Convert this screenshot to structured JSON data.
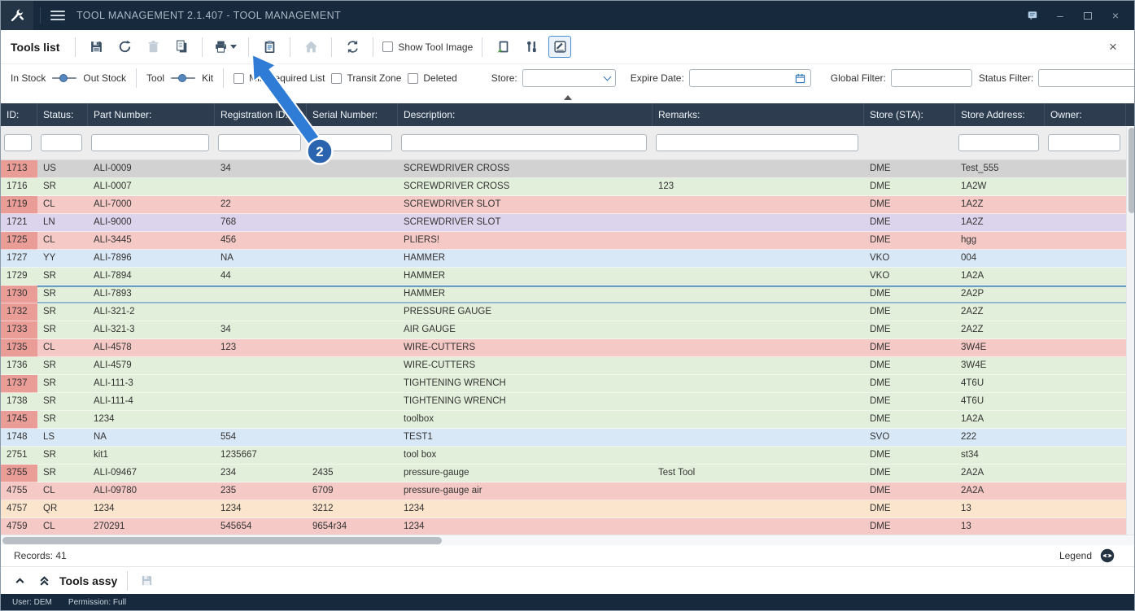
{
  "colors": {
    "titlebar": "#17293c",
    "table_header": "#2d3c4e",
    "accent": "#2e75b6",
    "row_green": "#e2efda",
    "row_pink": "#f5c9c6",
    "row_purple": "#dcd4ec",
    "row_blue": "#d9e8f7",
    "row_orange": "#fce5cd",
    "row_gray": "#d2d2d2",
    "id_alert": "#ea9c97",
    "callout_blue": "#2f7cd6",
    "callout_badge": "#2a63ae"
  },
  "titlebar": {
    "title": "TOOL MANAGEMENT 2.1.407 - TOOL MANAGEMENT",
    "minimize": "–",
    "close": "×"
  },
  "toolbar": {
    "heading": "Tools list",
    "show_tool_image": "Show Tool Image",
    "close": "×",
    "icons": [
      "save",
      "refresh",
      "delete",
      "copy",
      "print",
      "paste",
      "home",
      "transfer",
      "import-tool",
      "tool-settings",
      "edit"
    ]
  },
  "filterbar": {
    "in_stock": "In Stock",
    "out_stock": "Out Stock",
    "tool": "Tool",
    "kit": "Kit",
    "min_required_list": "Min Required List",
    "transit_zone": "Transit Zone",
    "deleted": "Deleted",
    "store_label": "Store:",
    "store_value": "",
    "expire_date_label": "Expire Date:",
    "expire_date_value": "",
    "global_filter_label": "Global Filter:",
    "global_filter_value": "",
    "status_filter_label": "Status Filter:",
    "status_filter_value": ""
  },
  "table": {
    "columns": [
      {
        "label": "ID:",
        "filter": true
      },
      {
        "label": "Status:",
        "filter": true
      },
      {
        "label": "Part Number:",
        "filter": true
      },
      {
        "label": "Registration ID:",
        "filter": true
      },
      {
        "label": "Serial Number:",
        "filter": true
      },
      {
        "label": "Description:",
        "filter": true
      },
      {
        "label": "Remarks:",
        "filter": true
      },
      {
        "label": "Store (STA):",
        "filter": false
      },
      {
        "label": "Store Address:",
        "filter": true
      },
      {
        "label": "Owner:",
        "filter": true
      }
    ],
    "rows": [
      {
        "id": "1713",
        "status": "US",
        "part_number": "ALI-0009",
        "registration_id": "34",
        "serial_number": "",
        "description": "SCREWDRIVER CROSS",
        "remarks": "",
        "store": "DME",
        "store_address": "Test_555",
        "owner": "",
        "color": "gray",
        "id_alert": true,
        "selected": false
      },
      {
        "id": "1716",
        "status": "SR",
        "part_number": "ALI-0007",
        "registration_id": "",
        "serial_number": "",
        "description": "SCREWDRIVER CROSS",
        "remarks": "123",
        "store": "DME",
        "store_address": "1A2W",
        "owner": "",
        "color": "green",
        "id_alert": false,
        "selected": false
      },
      {
        "id": "1719",
        "status": "CL",
        "part_number": "ALI-7000",
        "registration_id": "22",
        "serial_number": "",
        "description": "SCREWDRIVER SLOT",
        "remarks": "",
        "store": "DME",
        "store_address": "1A2Z",
        "owner": "",
        "color": "pink",
        "id_alert": true,
        "selected": false
      },
      {
        "id": "1721",
        "status": "LN",
        "part_number": "ALI-9000",
        "registration_id": "768",
        "serial_number": "",
        "description": "SCREWDRIVER SLOT",
        "remarks": "",
        "store": "DME",
        "store_address": "1A2Z",
        "owner": "",
        "color": "purple",
        "id_alert": false,
        "selected": false
      },
      {
        "id": "1725",
        "status": "CL",
        "part_number": "ALI-3445",
        "registration_id": "456",
        "serial_number": "",
        "description": "PLIERS!",
        "remarks": "",
        "store": "DME",
        "store_address": "hgg",
        "owner": "",
        "color": "pink",
        "id_alert": true,
        "selected": false
      },
      {
        "id": "1727",
        "status": "YY",
        "part_number": "ALI-7896",
        "registration_id": "NA",
        "serial_number": "",
        "description": "HAMMER",
        "remarks": "",
        "store": "VKO",
        "store_address": "004",
        "owner": "",
        "color": "blue",
        "id_alert": false,
        "selected": false
      },
      {
        "id": "1729",
        "status": "SR",
        "part_number": "ALI-7894",
        "registration_id": "44",
        "serial_number": "",
        "description": "HAMMER",
        "remarks": "",
        "store": "VKO",
        "store_address": "1A2A",
        "owner": "",
        "color": "green",
        "id_alert": false,
        "selected": false
      },
      {
        "id": "1730",
        "status": "SR",
        "part_number": "ALI-7893",
        "registration_id": "",
        "serial_number": "",
        "description": "HAMMER",
        "remarks": "",
        "store": "DME",
        "store_address": "2A2P",
        "owner": "",
        "color": "green",
        "id_alert": true,
        "selected": true
      },
      {
        "id": "1732",
        "status": "SR",
        "part_number": "ALI-321-2",
        "registration_id": "",
        "serial_number": "",
        "description": "PRESSURE GAUGE",
        "remarks": "",
        "store": "DME",
        "store_address": "2A2Z",
        "owner": "",
        "color": "green",
        "id_alert": true,
        "selected": false
      },
      {
        "id": "1733",
        "status": "SR",
        "part_number": "ALI-321-3",
        "registration_id": "34",
        "serial_number": "",
        "description": "AIR GAUGE",
        "remarks": "",
        "store": "DME",
        "store_address": "2A2Z",
        "owner": "",
        "color": "green",
        "id_alert": true,
        "selected": false
      },
      {
        "id": "1735",
        "status": "CL",
        "part_number": "ALI-4578",
        "registration_id": "123",
        "serial_number": "",
        "description": "WIRE-CUTTERS",
        "remarks": "",
        "store": "DME",
        "store_address": "3W4E",
        "owner": "",
        "color": "pink",
        "id_alert": true,
        "selected": false
      },
      {
        "id": "1736",
        "status": "SR",
        "part_number": "ALI-4579",
        "registration_id": "",
        "serial_number": "",
        "description": "WIRE-CUTTERS",
        "remarks": "",
        "store": "DME",
        "store_address": "3W4E",
        "owner": "",
        "color": "green",
        "id_alert": false,
        "selected": false
      },
      {
        "id": "1737",
        "status": "SR",
        "part_number": "ALI-111-3",
        "registration_id": "",
        "serial_number": "",
        "description": "TIGHTENING WRENCH",
        "remarks": "",
        "store": "DME",
        "store_address": "4T6U",
        "owner": "",
        "color": "green",
        "id_alert": true,
        "selected": false
      },
      {
        "id": "1738",
        "status": "SR",
        "part_number": "ALI-111-4",
        "registration_id": "",
        "serial_number": "",
        "description": "TIGHTENING WRENCH",
        "remarks": "",
        "store": "DME",
        "store_address": "4T6U",
        "owner": "",
        "color": "green",
        "id_alert": false,
        "selected": false
      },
      {
        "id": "1745",
        "status": "SR",
        "part_number": "1234",
        "registration_id": "",
        "serial_number": "",
        "description": "toolbox",
        "remarks": "",
        "store": "DME",
        "store_address": "1A2A",
        "owner": "",
        "color": "green",
        "id_alert": true,
        "selected": false
      },
      {
        "id": "1748",
        "status": "LS",
        "part_number": "NA",
        "registration_id": "554",
        "serial_number": "",
        "description": "TEST1",
        "remarks": "",
        "store": "SVO",
        "store_address": "222",
        "owner": "",
        "color": "blue",
        "id_alert": false,
        "selected": false
      },
      {
        "id": "2751",
        "status": "SR",
        "part_number": "kit1",
        "registration_id": "1235667",
        "serial_number": "",
        "description": "tool box",
        "remarks": "",
        "store": "DME",
        "store_address": "st34",
        "owner": "",
        "color": "green",
        "id_alert": false,
        "selected": false
      },
      {
        "id": "3755",
        "status": "SR",
        "part_number": "ALI-09467",
        "registration_id": "234",
        "serial_number": "2435",
        "description": "pressure-gauge",
        "remarks": "Test Tool",
        "store": "DME",
        "store_address": "2A2A",
        "owner": "",
        "color": "green",
        "id_alert": true,
        "selected": false
      },
      {
        "id": "4755",
        "status": "CL",
        "part_number": "ALI-09780",
        "registration_id": "235",
        "serial_number": "6709",
        "description": "pressure-gauge air",
        "remarks": "",
        "store": "DME",
        "store_address": "2A2A",
        "owner": "",
        "color": "pink",
        "id_alert": false,
        "selected": false
      },
      {
        "id": "4757",
        "status": "QR",
        "part_number": "1234",
        "registration_id": "1234",
        "serial_number": "3212",
        "description": "1234",
        "remarks": "",
        "store": "DME",
        "store_address": "13",
        "owner": "",
        "color": "orange",
        "id_alert": false,
        "selected": false
      },
      {
        "id": "4759",
        "status": "CL",
        "part_number": "270291",
        "registration_id": "545654",
        "serial_number": "9654r34",
        "description": "1234",
        "remarks": "",
        "store": "DME",
        "store_address": "13",
        "owner": "",
        "color": "pink",
        "id_alert": false,
        "selected": false
      }
    ]
  },
  "footer": {
    "records": "Records: 41",
    "legend": "Legend"
  },
  "assy": {
    "heading": "Tools assy"
  },
  "statusbar": {
    "user": "User: DEM",
    "permission": "Permission: Full"
  },
  "callout": {
    "step": "2"
  }
}
